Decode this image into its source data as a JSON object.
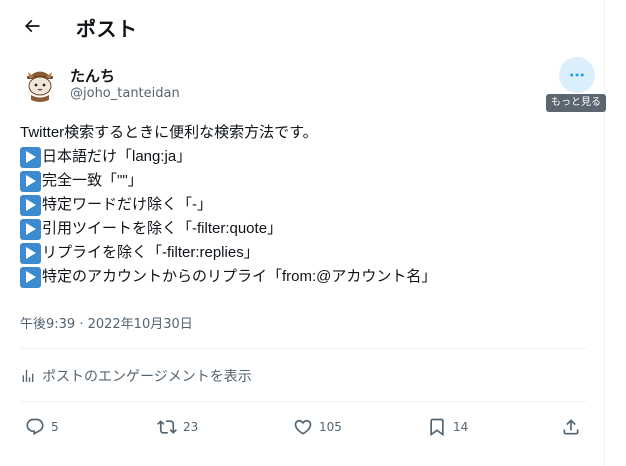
{
  "header": {
    "title": "ポスト",
    "back_icon": "arrow-left-icon"
  },
  "author": {
    "display_name": "たんち",
    "handle": "@joho_tanteidan"
  },
  "more": {
    "icon": "more-horizontal-icon",
    "tooltip": "もっと見る"
  },
  "tweet": {
    "intro": "Twitter検索するときに便利な検索方法です。",
    "bullet_icon": "play-button-emoji",
    "items": [
      "日本語だけ「lang:ja」",
      "完全一致「\"\"」",
      "特定ワードだけ除く「-」",
      "引用ツイートを除く「-filter:quote」",
      "リプライを除く「-filter:replies」",
      "特定のアカウントからのリプライ「from:@アカウント名」"
    ],
    "timestamp": "午後9:39 · 2022年10月30日"
  },
  "engagement": {
    "label": "ポストのエンゲージメントを表示"
  },
  "actions": {
    "replies": "5",
    "reposts": "23",
    "likes": "105",
    "bookmarks": "14"
  },
  "colors": {
    "accent": "#1d9bf0",
    "secondary_text": "#536471",
    "divider": "#eff3f4",
    "emoji_blue": "#3c8ad0"
  }
}
